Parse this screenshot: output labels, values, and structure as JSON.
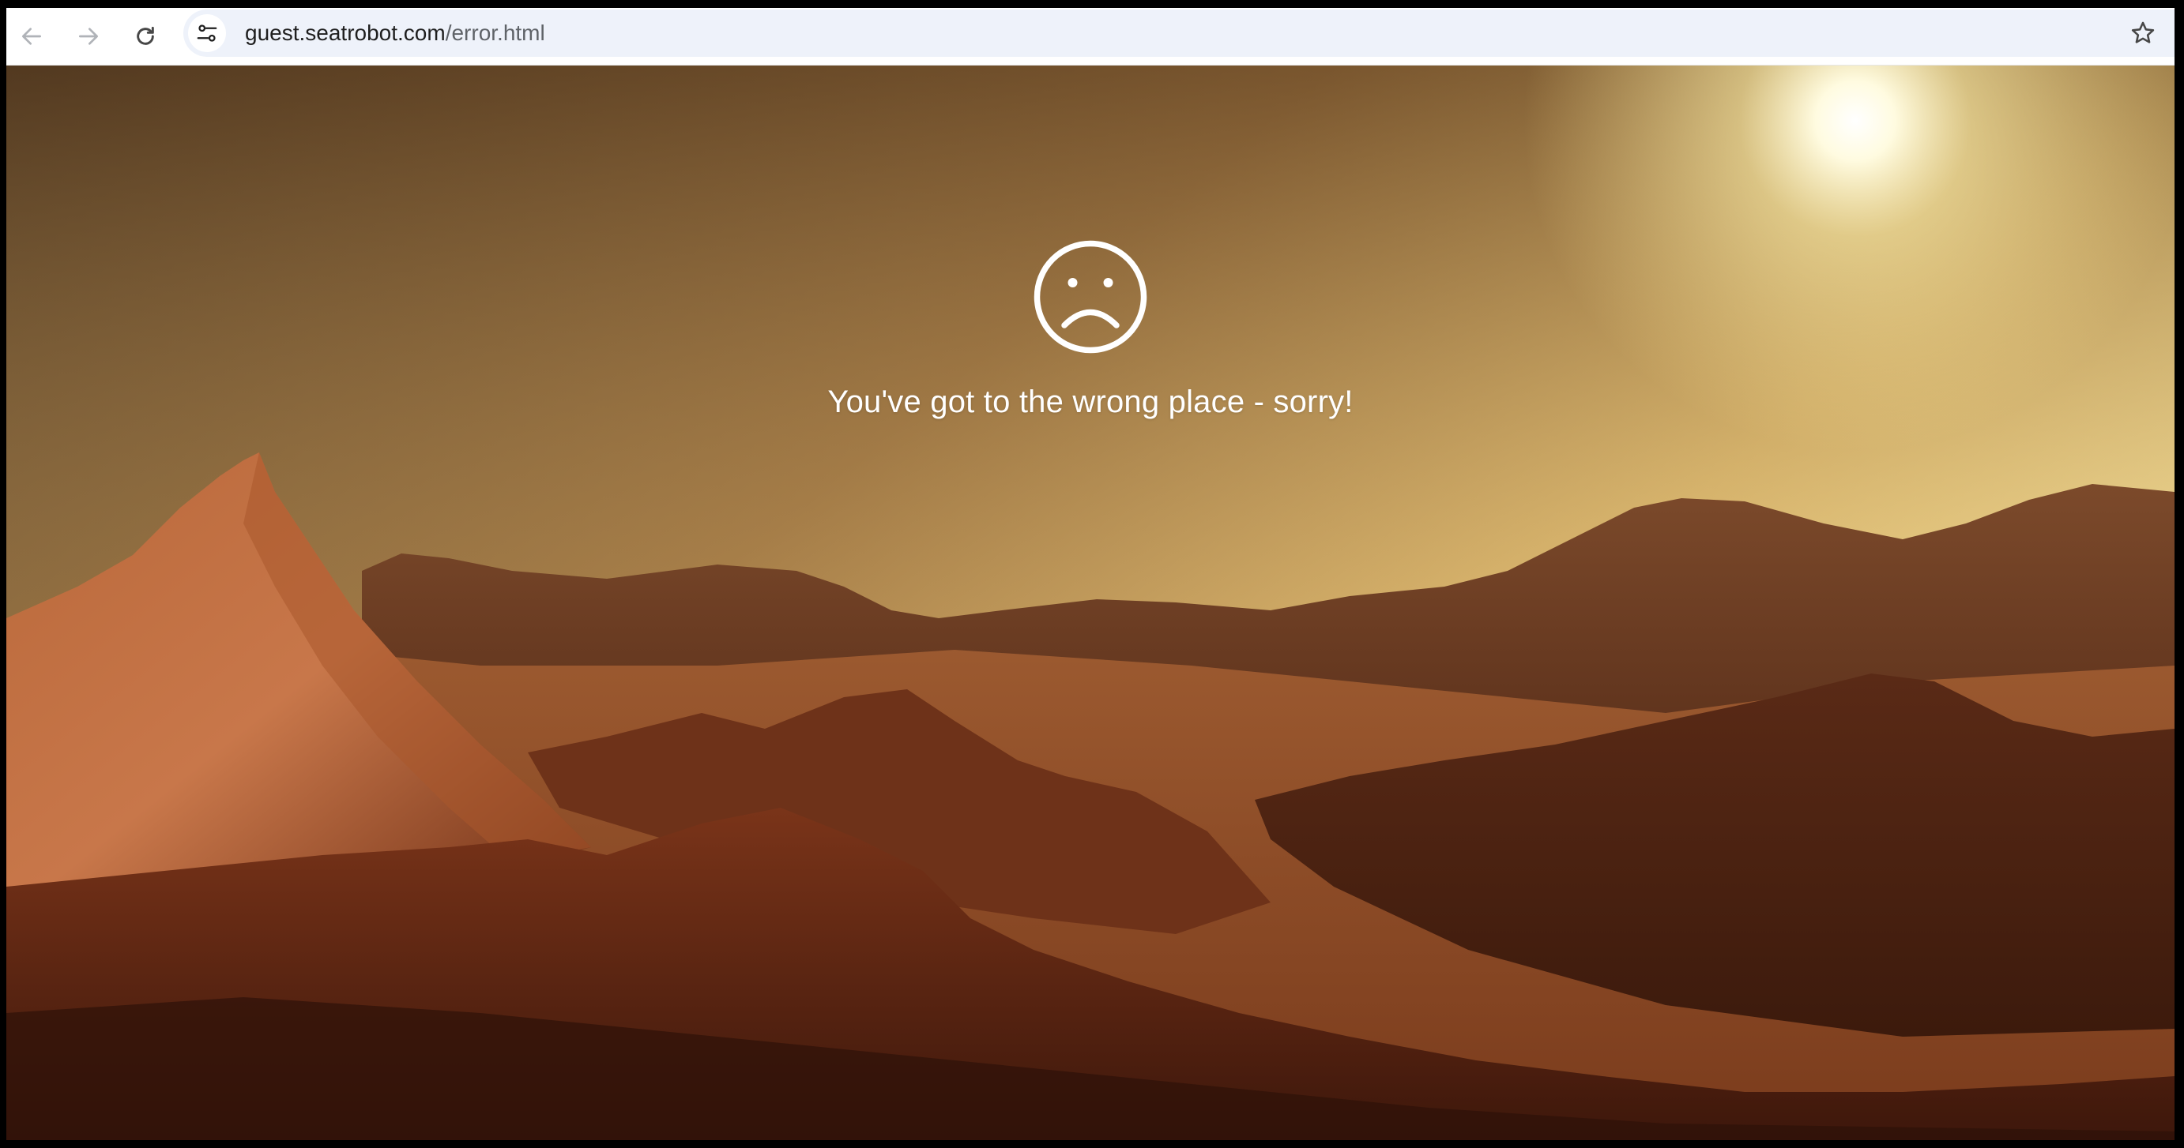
{
  "browser": {
    "back_icon": "arrow-left-icon",
    "forward_icon": "arrow-right-icon",
    "reload_icon": "reload-icon",
    "site_info_icon": "tune-icon",
    "bookmark_icon": "star-icon",
    "url": {
      "host": "guest.seatrobot.com",
      "path": "/error.html"
    }
  },
  "page": {
    "icon": "sad-face-icon",
    "message": "You've got to the wrong place - sorry!",
    "colors": {
      "sky_top": "#6a4a2a",
      "sky_glow": "#f3d98a",
      "sun": "#fffbe0",
      "terrain": "#8a3f1e",
      "text": "#ffffff"
    }
  }
}
